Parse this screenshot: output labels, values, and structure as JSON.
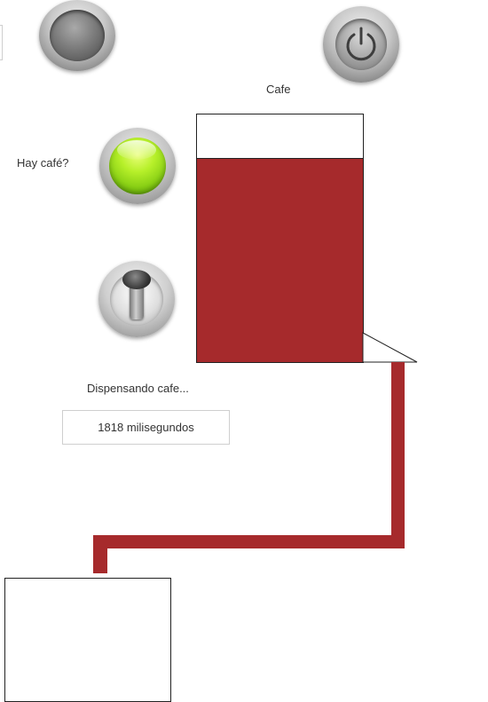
{
  "title": "Cafe",
  "indicator": {
    "label": "Hay café?",
    "state": "on",
    "color": "#9fe01c"
  },
  "status": {
    "text": "Dispensando cafe...",
    "counter": "1818 milisegundos"
  },
  "tank": {
    "fill_fraction": 0.82,
    "liquid_color": "#a62a2c"
  },
  "icons": {
    "main_button": "round-button-icon",
    "power": "power-icon",
    "toggle": "toggle-switch-icon"
  }
}
